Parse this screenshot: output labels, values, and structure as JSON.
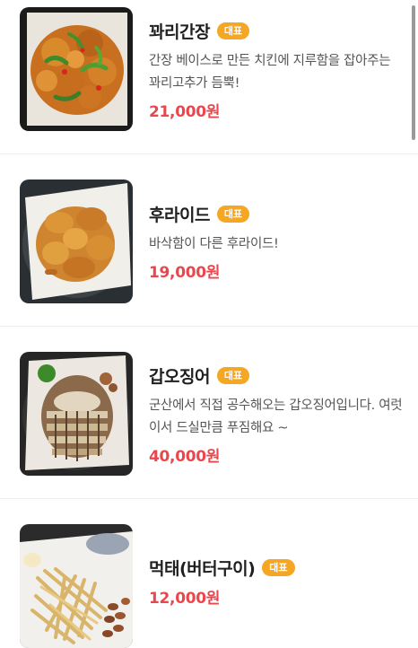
{
  "menu": {
    "items": [
      {
        "name": "꽈리간장",
        "badge": "대표",
        "description": "간장 베이스로 만든 치킨에 지루함을 잡아주는 꽈리고추가 듬뿍!",
        "price": "21,000원",
        "image_icon": "soy-garlic-chicken-photo"
      },
      {
        "name": "후라이드",
        "badge": "대표",
        "description": "바삭함이 다른 후라이드!",
        "price": "19,000원",
        "image_icon": "fried-chicken-photo"
      },
      {
        "name": "갑오징어",
        "badge": "대표",
        "description": "군산에서 직접 공수해오는 갑오징어입니다. 여럿이서 드실만큼 푸짐해요 ~",
        "price": "40,000원",
        "image_icon": "dried-cuttlefish-photo"
      },
      {
        "name": "먹태(버터구이)",
        "badge": "대표",
        "description": "",
        "price": "12,000원",
        "image_icon": "buttered-dried-pollack-photo"
      }
    ]
  }
}
